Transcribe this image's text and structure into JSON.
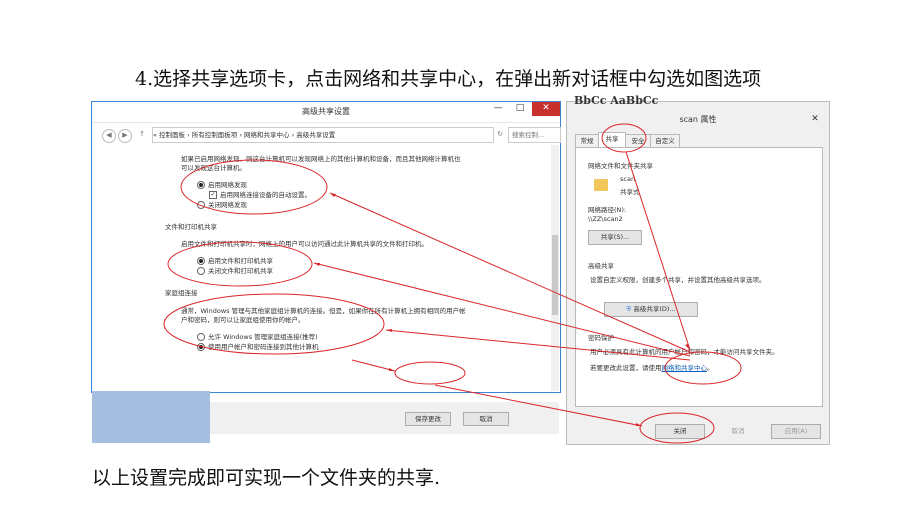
{
  "heading": "4.选择共享选项卡，点击网络和共享中心，在弹出新对话框中勾选如图选项",
  "footer": "以上设置完成即可实现一个文件夹的共享.",
  "overlay_text": "BbCc AaBbCc",
  "left_window": {
    "title": "高级共享设置",
    "controls": {
      "minimize": "—",
      "maximize": "□",
      "close": "✕"
    },
    "address": "«  控制面板  ›  所有控制面板项  ›  网络和共享中心  ›  高级共享设置",
    "search_placeholder": "搜索控制...",
    "network_discovery": {
      "desc1": "如果已启用网络发现，则这台计算机可以发现网络上的其他计算机和设备，而且其他网络计算机也",
      "desc2": "可以发现这台计算机。",
      "option_on": "启用网络发现",
      "auto_setup": "启用网络连接设备的自动设置。",
      "option_off": "关闭网络发现"
    },
    "file_printer": {
      "header": "文件和打印机共享",
      "desc": "启用文件和打印机共享时，网络上的用户可以访问通过此计算机共享的文件和打印机。",
      "option_on": "启用文件和打印机共享",
      "option_off": "关闭文件和打印机共享"
    },
    "homegroup": {
      "header": "家庭组连接",
      "desc1": "通常，Windows 管理与其他家庭组计算机的连接。但是，如果你在所有计算机上拥有相同的用户帐",
      "desc2": "户和密码，则可以让家庭组使用你的帐户。",
      "option_allow": "允许 Windows 管理家庭组连接(推荐)",
      "option_user": "使用用户帐户和密码连接到其他计算机"
    },
    "save_button": "保存更改",
    "cancel_button": "取消"
  },
  "right_window": {
    "title": "scan 属性",
    "tabs": [
      "常规",
      "共享",
      "安全",
      "自定义"
    ],
    "network_share_header": "网络文件和文件夹共享",
    "folder_name": "scan",
    "folder_state": "共享式",
    "network_path_label": "网络路径(N):",
    "network_path": "\\\\ZZ\\scan2",
    "share_button": "共享(S)...",
    "advanced_header": "高级共享",
    "advanced_desc": "设置自定义权限，创建多个共享，并设置其他高级共享选项。",
    "advanced_button": "高级共享(D)...",
    "password_header": "密码保护",
    "password_desc": "用户必须具有此计算机的用户帐户和密码，才能访问共享文件夹。",
    "password_change_prefix": "若要更改此设置，请使用",
    "password_link": "网络和共享中心",
    "password_change_suffix": "。",
    "close_button": "关闭",
    "cancel_button": "取消",
    "apply_button": "应用(A)"
  },
  "annotation_color": "#d9262a"
}
